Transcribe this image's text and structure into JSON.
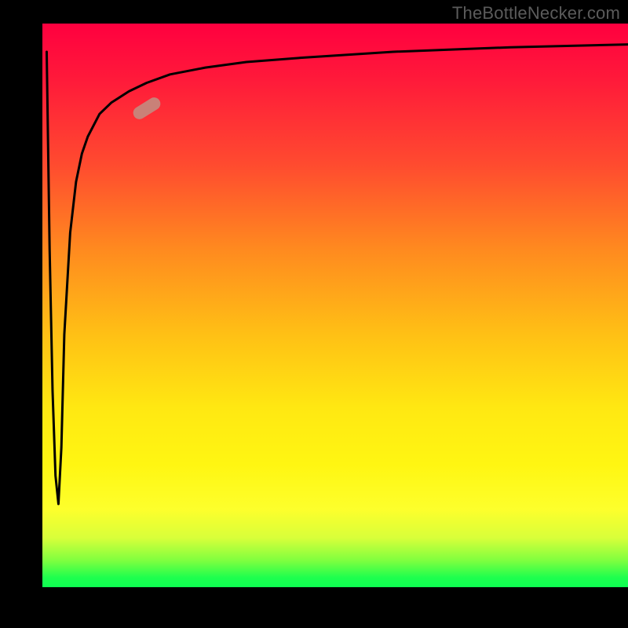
{
  "attribution": "TheBottleNecker.com",
  "chart_data": {
    "type": "line",
    "title": "",
    "xlabel": "",
    "ylabel": "",
    "xlim": [
      0,
      100
    ],
    "ylim": [
      0,
      100
    ],
    "background_gradient": {
      "direction": "vertical",
      "stops": [
        {
          "pos": 0.0,
          "color": "#ff003f"
        },
        {
          "pos": 0.5,
          "color": "#ffc015"
        },
        {
          "pos": 0.8,
          "color": "#fff612"
        },
        {
          "pos": 1.0,
          "color": "#0aff52"
        }
      ]
    },
    "series": [
      {
        "name": "bottleneck-curve",
        "stroke": "#000000",
        "x": [
          1.0,
          1.5,
          2.0,
          2.5,
          3.0,
          3.5,
          4.0,
          5.0,
          6.0,
          7.0,
          8.0,
          10.0,
          12.0,
          15.0,
          18.0,
          22.0,
          28.0,
          35.0,
          45.0,
          60.0,
          80.0,
          100.0
        ],
        "y": [
          95,
          60,
          35,
          20,
          15,
          25,
          45,
          63,
          72,
          77,
          80,
          84,
          86,
          88,
          89.5,
          91,
          92.2,
          93.2,
          94.0,
          95.0,
          95.8,
          96.3
        ]
      }
    ],
    "marker": {
      "name": "highlight-segment",
      "color": "#c98178",
      "x": 18,
      "y": 85,
      "angle_deg": -32
    }
  }
}
